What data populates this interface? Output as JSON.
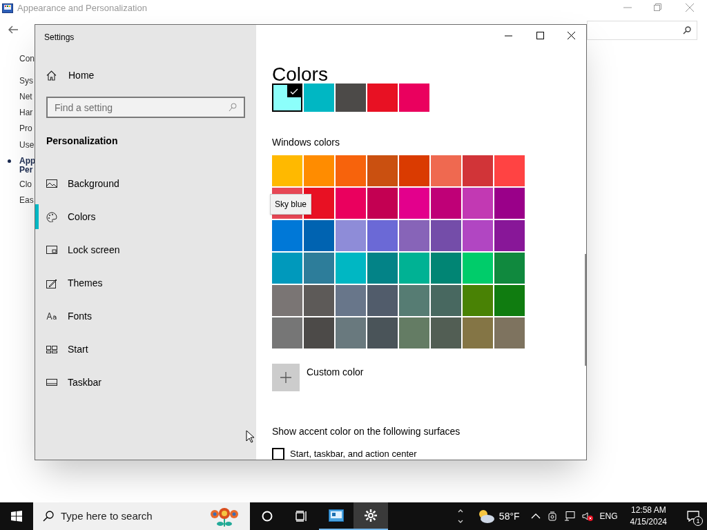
{
  "background_window": {
    "title": "Appearance and Personalization",
    "sidebar": [
      {
        "label": "Con",
        "selected": false
      },
      {
        "label": "Sys",
        "selected": false
      },
      {
        "label": "Net",
        "selected": false
      },
      {
        "label": "Har",
        "selected": false
      },
      {
        "label": "Pro",
        "selected": false
      },
      {
        "label": "Use",
        "selected": false
      },
      {
        "label": "App\nPer",
        "selected": true
      },
      {
        "label": "Clo",
        "selected": false
      },
      {
        "label": "Eas",
        "selected": false
      }
    ]
  },
  "settings": {
    "title": "Settings",
    "home": "Home",
    "search": {
      "placeholder": "Find a setting"
    },
    "section": "Personalization",
    "nav": [
      {
        "label": "Background",
        "selected": false
      },
      {
        "label": "Colors",
        "selected": true
      },
      {
        "label": "Lock screen",
        "selected": false
      },
      {
        "label": "Themes",
        "selected": false
      },
      {
        "label": "Fonts",
        "selected": false
      },
      {
        "label": "Start",
        "selected": false
      },
      {
        "label": "Taskbar",
        "selected": false
      }
    ],
    "heading": "Colors",
    "recent_colors": [
      {
        "color": "#8cfffb",
        "selected": true
      },
      {
        "color": "#00b7c3",
        "selected": false
      },
      {
        "color": "#4c4a48",
        "selected": false
      },
      {
        "color": "#e81123",
        "selected": false
      },
      {
        "color": "#ea005e",
        "selected": false
      }
    ],
    "windows_colors_label": "Windows colors",
    "windows_colors": [
      {
        "color": "#ffb900"
      },
      {
        "color": "#ff8c00"
      },
      {
        "color": "#f7630c"
      },
      {
        "color": "#ca5010"
      },
      {
        "color": "#da3b01"
      },
      {
        "color": "#ef6950"
      },
      {
        "color": "#d13438"
      },
      {
        "color": "#ff4343"
      },
      {
        "color": "#e74856"
      },
      {
        "color": "#e81123"
      },
      {
        "color": "#ea005e"
      },
      {
        "color": "#c30052"
      },
      {
        "color": "#e3008c"
      },
      {
        "color": "#bf0077"
      },
      {
        "color": "#c239b3"
      },
      {
        "color": "#9a0089"
      },
      {
        "color": "#0078d7"
      },
      {
        "color": "#0063b1"
      },
      {
        "color": "#8e8cd8"
      },
      {
        "color": "#6b69d6"
      },
      {
        "color": "#8764b8"
      },
      {
        "color": "#744da9"
      },
      {
        "color": "#b146c2"
      },
      {
        "color": "#881798"
      },
      {
        "color": "#0099bc"
      },
      {
        "color": "#2d7d9a"
      },
      {
        "color": "#00b7c3"
      },
      {
        "color": "#038387"
      },
      {
        "color": "#00b294"
      },
      {
        "color": "#018574"
      },
      {
        "color": "#00cc6a"
      },
      {
        "color": "#10893e"
      },
      {
        "color": "#7a7574"
      },
      {
        "color": "#5d5a58"
      },
      {
        "color": "#68768a"
      },
      {
        "color": "#515c6b"
      },
      {
        "color": "#567c73"
      },
      {
        "color": "#486860"
      },
      {
        "color": "#498205"
      },
      {
        "color": "#107c10"
      },
      {
        "color": "#767676"
      },
      {
        "color": "#4c4a48"
      },
      {
        "color": "#69797e"
      },
      {
        "color": "#4a5459"
      },
      {
        "color": "#647c64"
      },
      {
        "color": "#525e54"
      },
      {
        "color": "#847545"
      },
      {
        "color": "#7e735f"
      }
    ],
    "tooltip": "Sky blue",
    "custom_color": "Custom color",
    "accent_label": "Show accent color on the following surfaces",
    "checkboxes": [
      {
        "label": "Start, taskbar, and action center",
        "checked": false
      }
    ]
  },
  "taskbar": {
    "search_placeholder": "Type here to search",
    "temperature": "58°F",
    "language": "ENG",
    "time": "12:58 AM",
    "date": "4/15/2024",
    "notifications": "1"
  }
}
